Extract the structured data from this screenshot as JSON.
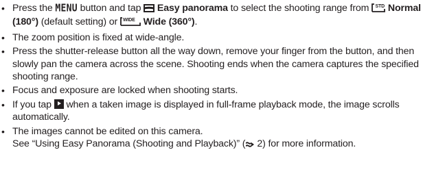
{
  "bullets": [
    {
      "segments": {
        "a": "Press the ",
        "menu": "MENU",
        "b": " button and tap ",
        "easy": "Easy panorama",
        "c": " to select the shooting range from ",
        "std_badge": "STD",
        "normal": "Normal (180°)",
        "d": " (default setting) or ",
        "wide_badge": "WIDE",
        "wide": "Wide (360°)",
        "e": "."
      }
    },
    {
      "text": "The zoom position is fixed at wide-angle."
    },
    {
      "text": "Press the shutter-release button all the way down, remove your finger from the button, and then slowly pan the camera across the scene. Shooting ends when the camera captures the specified shooting range."
    },
    {
      "text": "Focus and exposure are locked when shooting starts."
    },
    {
      "segments": {
        "a": "If you tap ",
        "b": " when a taken image is displayed in full-frame playback mode, the image scrolls automatically."
      }
    },
    {
      "segments": {
        "a": "The images cannot be edited on this camera.",
        "b": "See “Using Easy Panorama (Shooting and Playback)” (",
        "ref": "2",
        "c": ") for more information."
      }
    }
  ],
  "icons": {
    "panorama": "easy-panorama-icon",
    "normal": "panorama-normal-icon",
    "wide": "panorama-wide-icon",
    "play": "playback-icon",
    "reference": "reference-link-icon"
  },
  "colors": {
    "text": "#231f20"
  }
}
